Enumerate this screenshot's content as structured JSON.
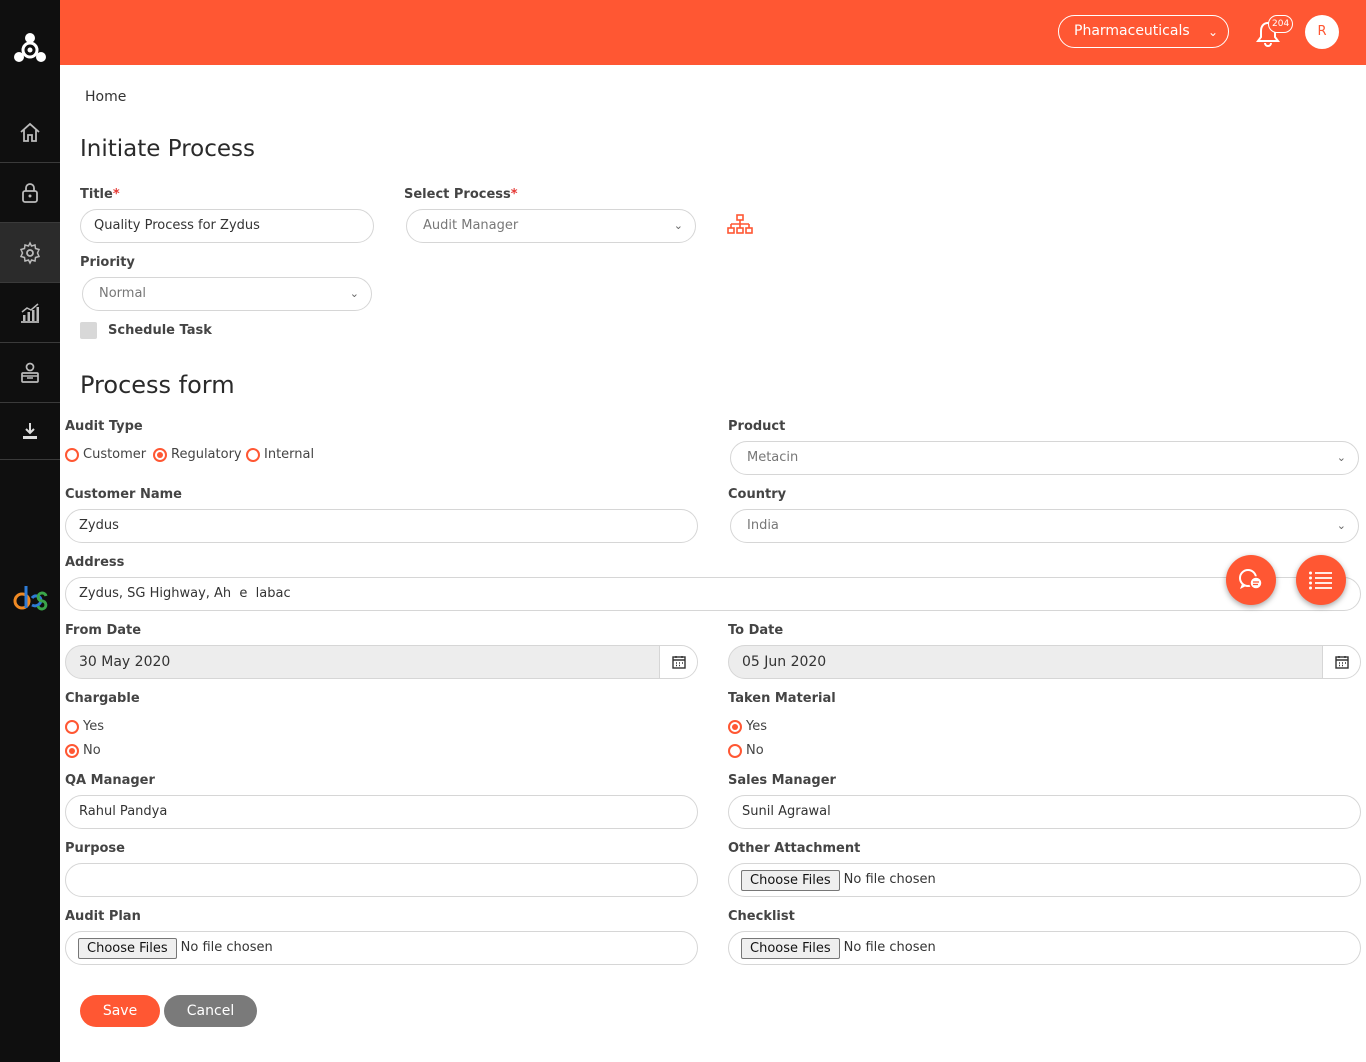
{
  "header": {
    "org_select": "Pharmaceuticals",
    "notification_count": "204",
    "avatar_initial": "R"
  },
  "breadcrumb": "Home",
  "initiate": {
    "heading": "Initiate Process",
    "title_label": "Title",
    "title_value": "Quality Process for Zydus",
    "process_label": "Select Process",
    "process_value": "Audit Manager",
    "priority_label": "Priority",
    "priority_value": "Normal",
    "schedule_label": "Schedule Task",
    "required_mark": "*"
  },
  "form": {
    "heading": "Process form",
    "audit_type": {
      "label": "Audit Type",
      "options": [
        "Customer",
        "Regulatory",
        "Internal"
      ],
      "selected": "Regulatory"
    },
    "product": {
      "label": "Product",
      "value": "Metacin"
    },
    "customer_name": {
      "label": "Customer Name",
      "value": "Zydus"
    },
    "country": {
      "label": "Country",
      "value": "India"
    },
    "address": {
      "label": "Address",
      "value": "Zydus, SG Highway, Ah  e  labac"
    },
    "from_date": {
      "label": "From Date",
      "value": "30 May 2020"
    },
    "to_date": {
      "label": "To Date",
      "value": "05 Jun 2020"
    },
    "chargable": {
      "label": "Chargable",
      "options": [
        "Yes",
        "No"
      ],
      "selected": "No"
    },
    "taken_material": {
      "label": "Taken Material",
      "options": [
        "Yes",
        "No"
      ],
      "selected": "Yes"
    },
    "qa_manager": {
      "label": "QA Manager",
      "value": "Rahul Pandya"
    },
    "sales_manager": {
      "label": "Sales Manager",
      "value": "Sunil Agrawal"
    },
    "purpose": {
      "label": "Purpose",
      "value": ""
    },
    "other_attachment": {
      "label": "Other Attachment"
    },
    "audit_plan": {
      "label": "Audit Plan"
    },
    "checklist": {
      "label": "Checklist"
    },
    "file_button": "Choose Files",
    "file_status": "No file chosen"
  },
  "actions": {
    "save": "Save",
    "cancel": "Cancel"
  },
  "colors": {
    "accent": "#ff5733",
    "sidebar": "#0f0f0f",
    "cancel": "#7a7a7a"
  },
  "icons": [
    "app-logo-icon",
    "home-icon",
    "lock-icon",
    "gear-icon",
    "chart-icon",
    "user-admin-icon",
    "download-icon",
    "bell-icon",
    "hierarchy-icon",
    "calendar-icon",
    "chat-icon",
    "list-icon",
    "brand-logo-icon"
  ]
}
